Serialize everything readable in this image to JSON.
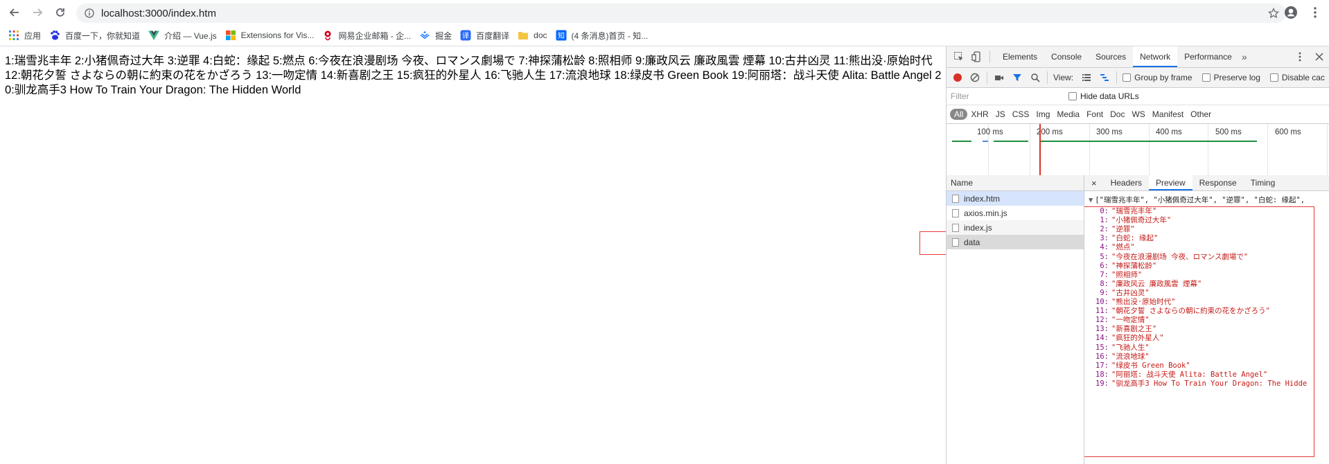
{
  "browser": {
    "url": "localhost:3000/index.htm"
  },
  "bookmarks": [
    {
      "label": "应用",
      "icon": "apps-grid-icon",
      "color": "#4285f4"
    },
    {
      "label": "百度一下，你就知道",
      "icon": "baidu-paw-icon",
      "color": "#2932e1"
    },
    {
      "label": "介绍 — Vue.js",
      "icon": "vue-logo-icon",
      "color": "#41b883"
    },
    {
      "label": "Extensions for Vis...",
      "icon": "windows-tiles-icon",
      "color": "#f25022"
    },
    {
      "label": "网易企业邮箱 - 企...",
      "icon": "netease-mail-icon",
      "color": "#d0021b"
    },
    {
      "label": "掘金",
      "icon": "juejin-logo-icon",
      "color": "#1e80ff"
    },
    {
      "label": "百度翻译",
      "icon": "baidu-translate-icon",
      "color": "#2a6cf6"
    },
    {
      "label": "doc",
      "icon": "folder-icon",
      "color": "#f4c542"
    },
    {
      "label": "(4 条消息)首页 - 知...",
      "icon": "zhihu-logo-icon",
      "color": "#0066ff"
    }
  ],
  "page": {
    "text": "1:瑞雪兆丰年 2:小猪佩奇过大年 3:逆罪 4:白蛇：缘起 5:燃点 6:今夜在浪漫剧场 今夜、ロマンス劇場で 7:神探蒲松龄 8:照相师 9:廉政风云 廉政風雲 煙幕 10:古井凶灵 11:熊出没·原始时代 12:朝花夕誓 さよならの朝に約束の花をかざろう 13:一吻定情 14:新喜剧之王 15:疯狂的外星人 16:飞驰人生 17:流浪地球 18:绿皮书 Green Book 19:阿丽塔：战斗天使 Alita: Battle Angel 20:驯龙高手3 How To Train Your Dragon: The Hidden World"
  },
  "devtools": {
    "tabs": [
      "Elements",
      "Console",
      "Sources",
      "Network",
      "Performance"
    ],
    "active_tab": "Network",
    "more": "»",
    "toolbar": {
      "view_label": "View:",
      "group_by_frame": "Group by frame",
      "preserve_log": "Preserve log",
      "disable_cache": "Disable cac"
    },
    "filter": {
      "placeholder": "Filter",
      "hide_data_urls": "Hide data URLs"
    },
    "types": [
      "All",
      "XHR",
      "JS",
      "CSS",
      "Img",
      "Media",
      "Font",
      "Doc",
      "WS",
      "Manifest",
      "Other"
    ],
    "timeline_ticks": [
      "100 ms",
      "200 ms",
      "300 ms",
      "400 ms",
      "500 ms",
      "600 ms"
    ],
    "name_header": "Name",
    "requests": [
      {
        "name": "index.htm"
      },
      {
        "name": "axios.min.js"
      },
      {
        "name": "index.js"
      },
      {
        "name": "data"
      }
    ],
    "detail_tabs": [
      "Headers",
      "Preview",
      "Response",
      "Timing"
    ],
    "active_detail_tab": "Preview",
    "close": "×",
    "preview": {
      "header": "[\"瑞雪兆丰年\", \"小猪佩奇过大年\", \"逆罪\", \"白蛇: 缘起\",",
      "items": [
        {
          "index": "0:",
          "value": "\"瑞雪兆丰年\""
        },
        {
          "index": "1:",
          "value": "\"小猪佩奇过大年\""
        },
        {
          "index": "2:",
          "value": "\"逆罪\""
        },
        {
          "index": "3:",
          "value": "\"白蛇: 缘起\""
        },
        {
          "index": "4:",
          "value": "\"燃点\""
        },
        {
          "index": "5:",
          "value": "\"今夜在浪漫剧场 今夜、ロマンス劇場で\""
        },
        {
          "index": "6:",
          "value": "\"神探蒲松龄\""
        },
        {
          "index": "7:",
          "value": "\"照相师\""
        },
        {
          "index": "8:",
          "value": "\"廉政风云 廉政風雲 煙幕\""
        },
        {
          "index": "9:",
          "value": "\"古井凶灵\""
        },
        {
          "index": "10:",
          "value": "\"熊出没·原始时代\""
        },
        {
          "index": "11:",
          "value": "\"朝花夕誓 さよならの朝に約束の花をかざろう\""
        },
        {
          "index": "12:",
          "value": "\"一吻定情\""
        },
        {
          "index": "13:",
          "value": "\"新喜剧之王\""
        },
        {
          "index": "14:",
          "value": "\"疯狂的外星人\""
        },
        {
          "index": "15:",
          "value": "\"飞驰人生\""
        },
        {
          "index": "16:",
          "value": "\"流浪地球\""
        },
        {
          "index": "17:",
          "value": "\"绿皮书 Green Book\""
        },
        {
          "index": "18:",
          "value": "\"阿丽塔: 战斗天使 Alita: Battle Angel\""
        },
        {
          "index": "19:",
          "value": "\"驯龙高手3 How To Train Your Dragon: The Hidde"
        }
      ]
    }
  }
}
